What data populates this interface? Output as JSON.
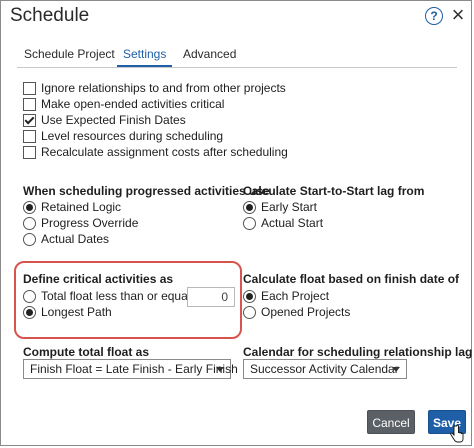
{
  "dialog": {
    "title": "Schedule",
    "help_icon": "?",
    "close_icon": "×"
  },
  "tabs": [
    {
      "label": "Schedule Project",
      "active": false
    },
    {
      "label": "Settings",
      "active": true
    },
    {
      "label": "Advanced",
      "active": false
    }
  ],
  "options": [
    {
      "label": "Ignore relationships to and from other projects",
      "checked": false
    },
    {
      "label": "Make open-ended activities critical",
      "checked": false
    },
    {
      "label": "Use Expected Finish Dates",
      "checked": true
    },
    {
      "label": "Level resources during scheduling",
      "checked": false
    },
    {
      "label": "Recalculate assignment costs after scheduling",
      "checked": false
    }
  ],
  "progressed": {
    "heading": "When scheduling progressed activities use",
    "choices": [
      {
        "label": "Retained Logic",
        "selected": true
      },
      {
        "label": "Progress Override",
        "selected": false
      },
      {
        "label": "Actual Dates",
        "selected": false
      }
    ]
  },
  "start_to_start": {
    "heading": "Calculate Start-to-Start lag from",
    "choices": [
      {
        "label": "Early Start",
        "selected": true
      },
      {
        "label": "Actual Start",
        "selected": false
      }
    ]
  },
  "critical": {
    "heading": "Define critical activities as",
    "choices": [
      {
        "label": "Total float less than or equal to",
        "selected": false
      },
      {
        "label": "Longest Path",
        "selected": true
      }
    ],
    "float_value": "0"
  },
  "float_basis": {
    "heading": "Calculate float based on finish date of",
    "choices": [
      {
        "label": "Each Project",
        "selected": true
      },
      {
        "label": "Opened Projects",
        "selected": false
      }
    ]
  },
  "total_float": {
    "heading": "Compute total float as",
    "selected": "Finish Float = Late Finish - Early Finish"
  },
  "calendar": {
    "heading": "Calendar for scheduling relationship lag",
    "selected": "Successor Activity Calendar"
  },
  "buttons": {
    "cancel": "Cancel",
    "save": "Save"
  },
  "colors": {
    "accent": "#1f5fa8",
    "highlight": "#d9534f",
    "cancel_bg": "#5b5f66"
  }
}
